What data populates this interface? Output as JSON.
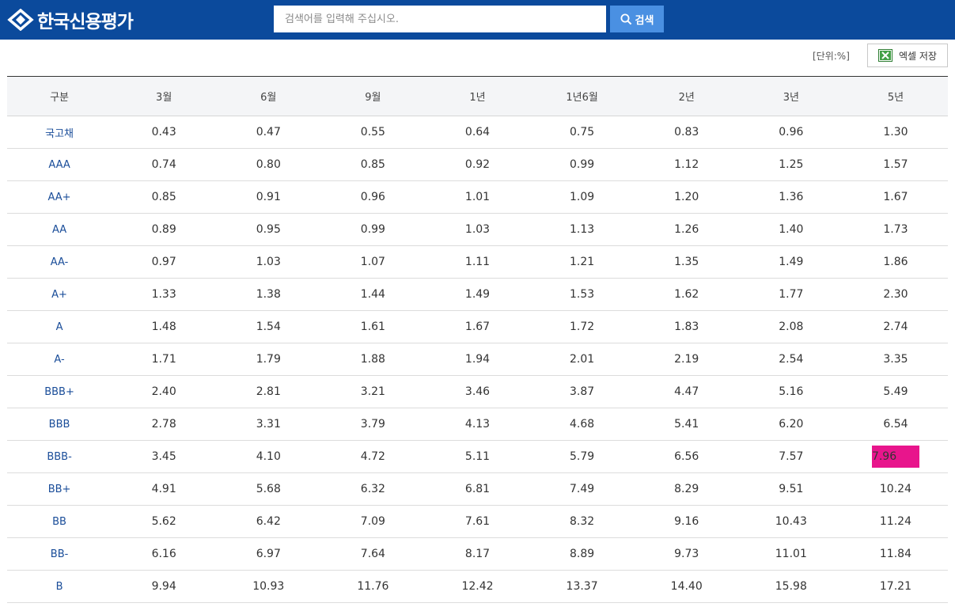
{
  "header": {
    "logo_text": "한국신용평가",
    "search_placeholder": "검색어를 입력해 주십시오.",
    "search_button": "검색"
  },
  "toolbar": {
    "unit_label": "[단위:%]",
    "excel_button": "엑셀 저장"
  },
  "table": {
    "columns": [
      "구분",
      "3월",
      "6월",
      "9월",
      "1년",
      "1년6월",
      "2년",
      "3년",
      "5년"
    ],
    "highlight": {
      "row": 10,
      "col": 8,
      "color": "#e8158c"
    },
    "rows": [
      {
        "grade": "국고채",
        "values": [
          "0.43",
          "0.47",
          "0.55",
          "0.64",
          "0.75",
          "0.83",
          "0.96",
          "1.30"
        ]
      },
      {
        "grade": "AAA",
        "values": [
          "0.74",
          "0.80",
          "0.85",
          "0.92",
          "0.99",
          "1.12",
          "1.25",
          "1.57"
        ]
      },
      {
        "grade": "AA+",
        "values": [
          "0.85",
          "0.91",
          "0.96",
          "1.01",
          "1.09",
          "1.20",
          "1.36",
          "1.67"
        ]
      },
      {
        "grade": "AA",
        "values": [
          "0.89",
          "0.95",
          "0.99",
          "1.03",
          "1.13",
          "1.26",
          "1.40",
          "1.73"
        ]
      },
      {
        "grade": "AA-",
        "values": [
          "0.97",
          "1.03",
          "1.07",
          "1.11",
          "1.21",
          "1.35",
          "1.49",
          "1.86"
        ]
      },
      {
        "grade": "A+",
        "values": [
          "1.33",
          "1.38",
          "1.44",
          "1.49",
          "1.53",
          "1.62",
          "1.77",
          "2.30"
        ]
      },
      {
        "grade": "A",
        "values": [
          "1.48",
          "1.54",
          "1.61",
          "1.67",
          "1.72",
          "1.83",
          "2.08",
          "2.74"
        ]
      },
      {
        "grade": "A-",
        "values": [
          "1.71",
          "1.79",
          "1.88",
          "1.94",
          "2.01",
          "2.19",
          "2.54",
          "3.35"
        ]
      },
      {
        "grade": "BBB+",
        "values": [
          "2.40",
          "2.81",
          "3.21",
          "3.46",
          "3.87",
          "4.47",
          "5.16",
          "5.49"
        ]
      },
      {
        "grade": "BBB",
        "values": [
          "2.78",
          "3.31",
          "3.79",
          "4.13",
          "4.68",
          "5.41",
          "6.20",
          "6.54"
        ]
      },
      {
        "grade": "BBB-",
        "values": [
          "3.45",
          "4.10",
          "4.72",
          "5.11",
          "5.79",
          "6.56",
          "7.57",
          "7.96"
        ]
      },
      {
        "grade": "BB+",
        "values": [
          "4.91",
          "5.68",
          "6.32",
          "6.81",
          "7.49",
          "8.29",
          "9.51",
          "10.24"
        ]
      },
      {
        "grade": "BB",
        "values": [
          "5.62",
          "6.42",
          "7.09",
          "7.61",
          "8.32",
          "9.16",
          "10.43",
          "11.24"
        ]
      },
      {
        "grade": "BB-",
        "values": [
          "6.16",
          "6.97",
          "7.64",
          "8.17",
          "8.89",
          "9.73",
          "11.01",
          "11.84"
        ]
      },
      {
        "grade": "B",
        "values": [
          "9.94",
          "10.93",
          "11.76",
          "12.42",
          "13.37",
          "14.40",
          "15.98",
          "17.21"
        ]
      }
    ]
  },
  "colors": {
    "header_bg": "#0b4a9c",
    "search_button_bg": "#4a90e2",
    "grade_text": "#1a4d99"
  }
}
